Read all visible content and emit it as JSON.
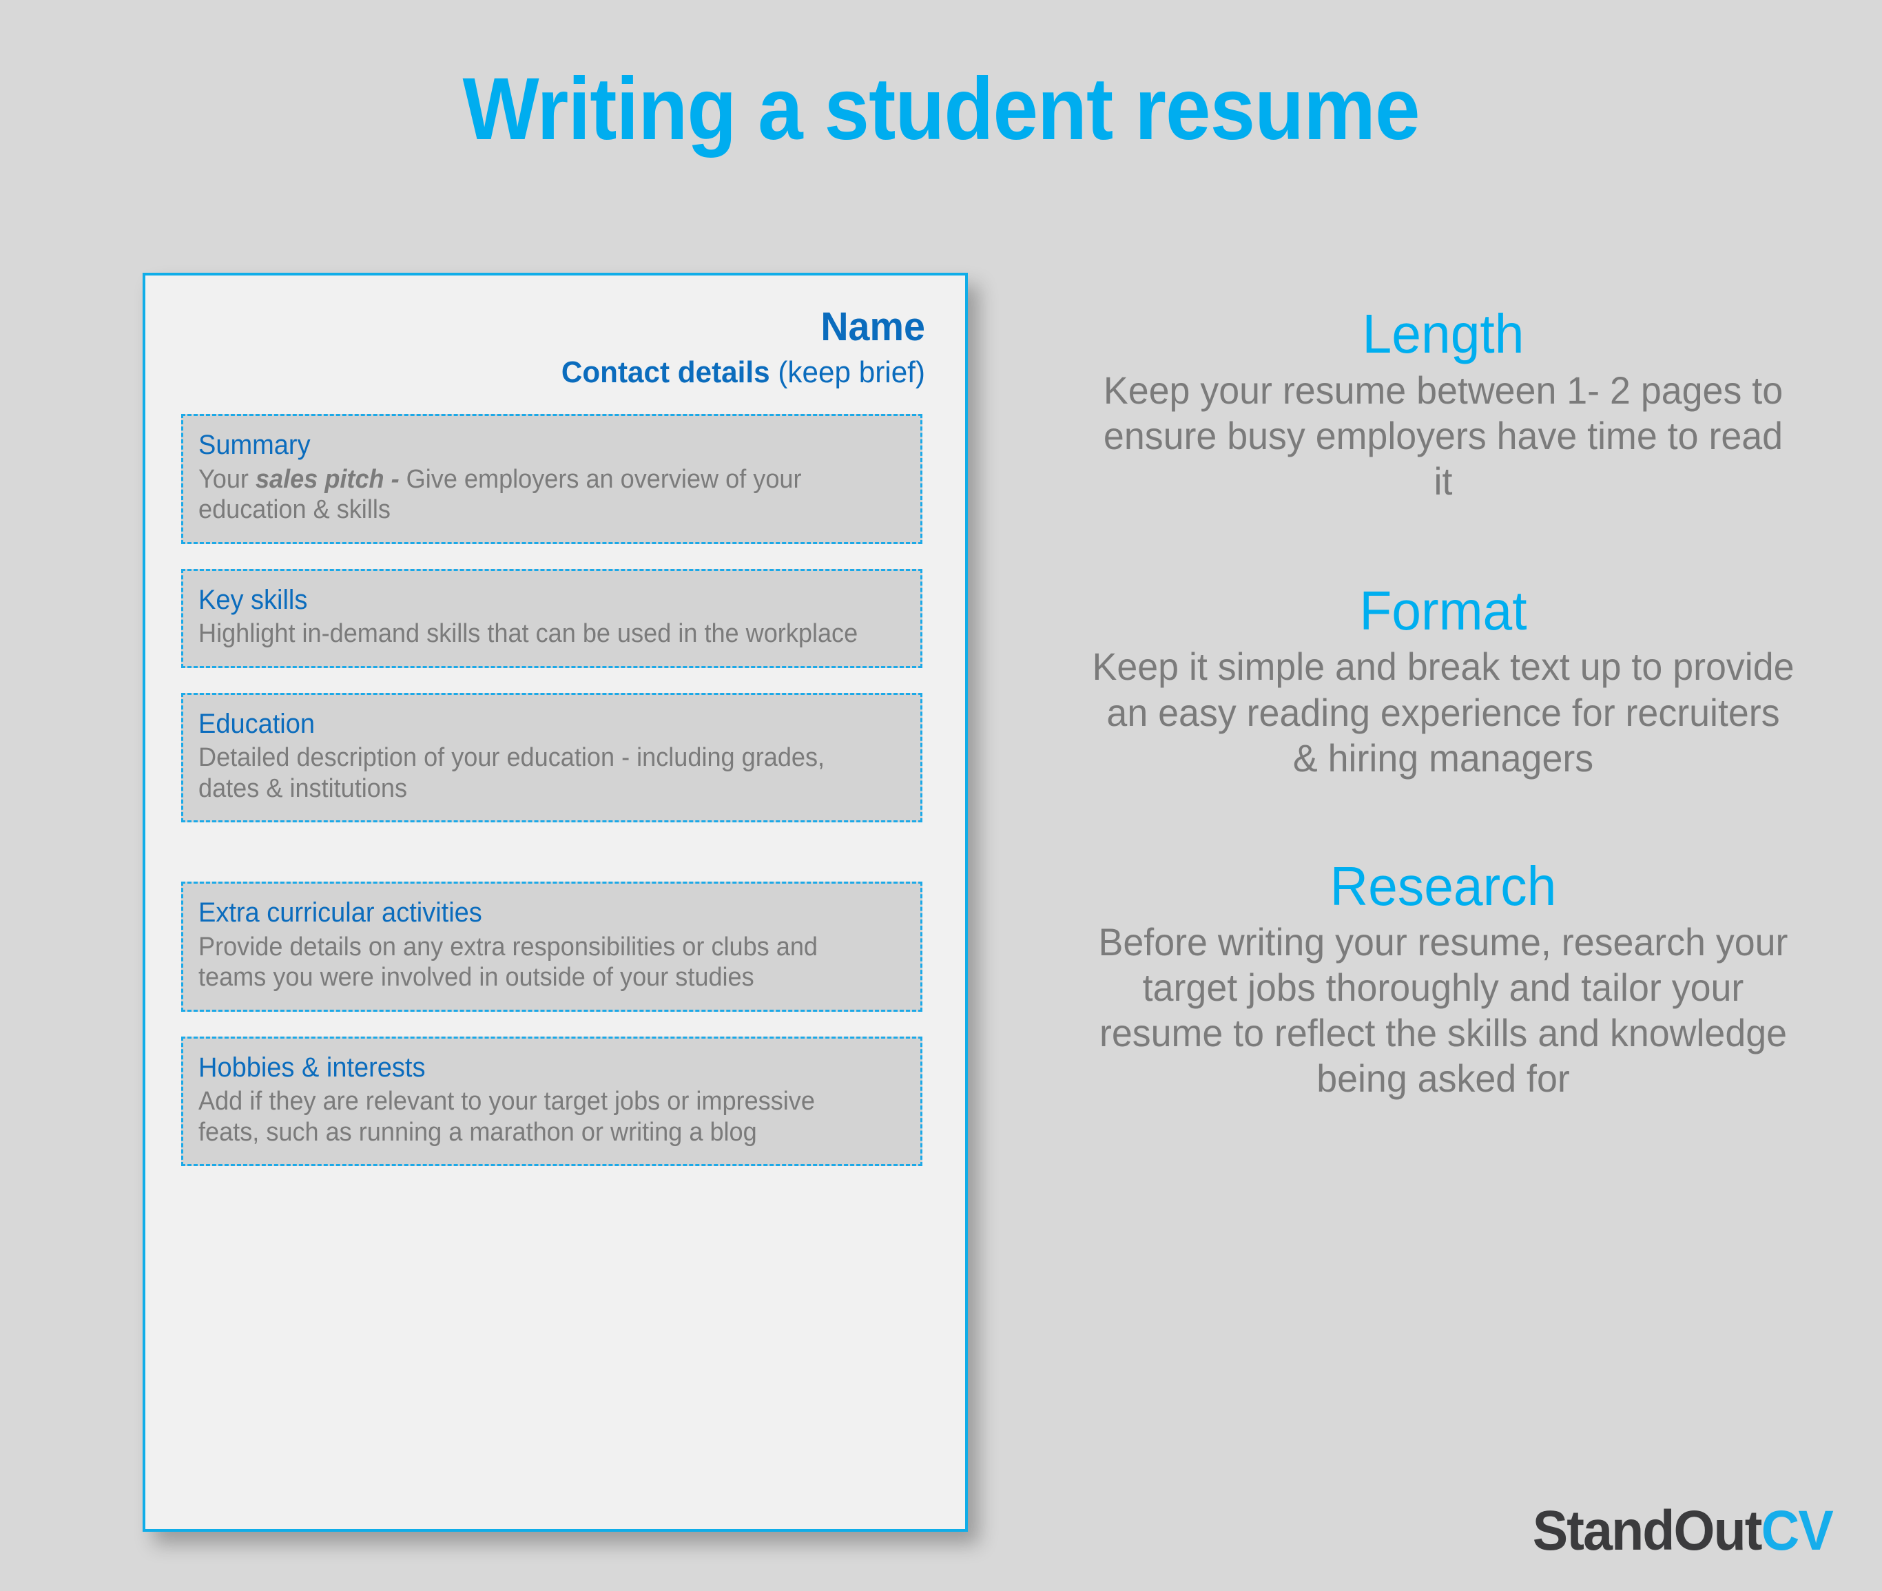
{
  "title": "Writing a student resume",
  "colors": {
    "accent_cyan": "#00AEEF",
    "heading_blue": "#0B6CBD",
    "dashed_border": "#1BA9E8",
    "body_gray": "#7B7B7B",
    "page_background": "#D8D8D8",
    "card_background": "#F1F1F1",
    "section_box_fill": "#D3D3D3",
    "logo_dark": "#3B3B3D"
  },
  "resume": {
    "header": {
      "name": "Name",
      "contact_bold": "Contact details",
      "contact_note": "(keep brief)"
    },
    "sections": [
      {
        "title": "Summary",
        "body_before": "Your ",
        "body_emphasis": "sales pitch -",
        "body_after": " Give employers an overview of your education & skills"
      },
      {
        "title": "Key skills",
        "body": "Highlight in-demand skills that can be used in the workplace"
      },
      {
        "title": "Education",
        "body": "Detailed description of your education - including grades, dates & institutions"
      },
      {
        "title": "Extra curricular activities",
        "body": "Provide details on any extra responsibilities or clubs and teams you were involved in outside of your studies"
      },
      {
        "title": "Hobbies & interests",
        "body": "Add if they are relevant to your target jobs or impressive feats, such as running a marathon or writing a blog"
      }
    ]
  },
  "tips": [
    {
      "heading": "Length",
      "text": "Keep your resume between 1- 2 pages to ensure busy employers have time to read it"
    },
    {
      "heading": "Format",
      "text": "Keep it simple and break text up to provide an easy reading experience for recruiters & hiring managers"
    },
    {
      "heading": "Research",
      "text": "Before writing your resume, research your target jobs thoroughly and tailor your resume to reflect the skills and knowledge being asked for"
    }
  ],
  "logo": {
    "dark_text": "StandOut",
    "accent_text": "CV"
  }
}
